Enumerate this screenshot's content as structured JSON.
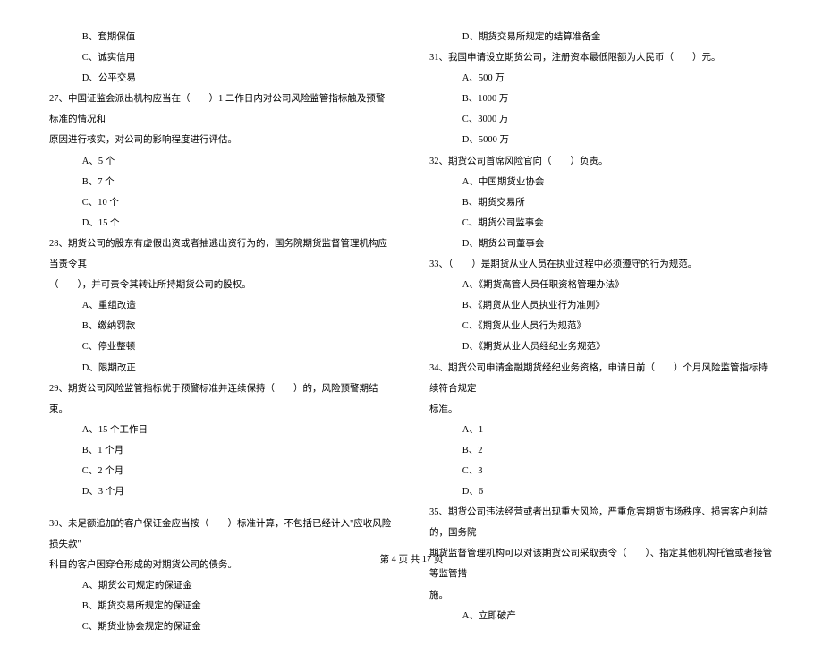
{
  "left": {
    "q26_opts": {
      "B": "B、套期保值",
      "C": "C、诚实信用",
      "D": "D、公平交易"
    },
    "q27": {
      "text": "27、中国证监会派出机构应当在（　　）1 二作日内对公司风险监管指标触及预警标准的情况和",
      "text2": "原因进行核实，对公司的影响程度进行评估。",
      "opts": {
        "A": "A、5 个",
        "B": "B、7 个",
        "C": "C、10 个",
        "D": "D、15 个"
      }
    },
    "q28": {
      "text": "28、期货公司的股东有虚假出资或者抽逃出资行为的，国务院期货监督管理机构应当责令其",
      "text2": "（　　），并可责令其转让所持期货公司的股权。",
      "opts": {
        "A": "A、重组改造",
        "B": "B、缴纳罚款",
        "C": "C、停业整顿",
        "D": "D、限期改正"
      }
    },
    "q29": {
      "text": "29、期货公司风险监管指标优于预警标准并连续保持（　　）的，风险预警期结束。",
      "opts": {
        "A": "A、15 个工作日",
        "B": "B、1 个月",
        "C": "C、2 个月",
        "D": "D、3 个月"
      }
    },
    "q30": {
      "text": "30、未足额追加的客户保证金应当按（　　）标准计算，不包括已经计入\"应收风险损失款\"",
      "text2": "科目的客户因穿仓形成的对期货公司的债务。",
      "opts": {
        "A": "A、期货公司规定的保证金",
        "B": "B、期货交易所规定的保证金",
        "C": "C、期货业协会规定的保证金"
      }
    }
  },
  "right": {
    "q30_D": "D、期货交易所规定的结算准备金",
    "q31": {
      "text": "31、我国申请设立期货公司，注册资本最低限额为人民币（　　）元。",
      "opts": {
        "A": "A、500 万",
        "B": "B、1000 万",
        "C": "C、3000 万",
        "D": "D、5000 万"
      }
    },
    "q32": {
      "text": "32、期货公司首席风险官向（　　）负责。",
      "opts": {
        "A": "A、中国期货业协会",
        "B": "B、期货交易所",
        "C": "C、期货公司监事会",
        "D": "D、期货公司董事会"
      }
    },
    "q33": {
      "text": "33、（　　）是期货从业人员在执业过程中必须遵守的行为规范。",
      "opts": {
        "A": "A、《期货高管人员任职资格管理办法》",
        "B": "B、《期货从业人员执业行为准则》",
        "C": "C、《期货从业人员行为规范》",
        "D": "D、《期货从业人员经纪业务规范》"
      }
    },
    "q34": {
      "text": "34、期货公司申请金融期货经纪业务资格，申请日前（　　）个月风险监管指标持续符合规定",
      "text2": "标准。",
      "opts": {
        "A": "A、1",
        "B": "B、2",
        "C": "C、3",
        "D": "D、6"
      }
    },
    "q35": {
      "text": "35、期货公司违法经营或者出现重大风险，严重危害期货市场秩序、损害客户利益的，国务院",
      "text2": "期货监督管理机构可以对该期货公司采取责令（　　）、指定其他机构托管或者接管等监管措",
      "text3": "施。",
      "opts": {
        "A": "A、立即破产"
      }
    }
  },
  "footer": "第 4 页 共 17 页"
}
